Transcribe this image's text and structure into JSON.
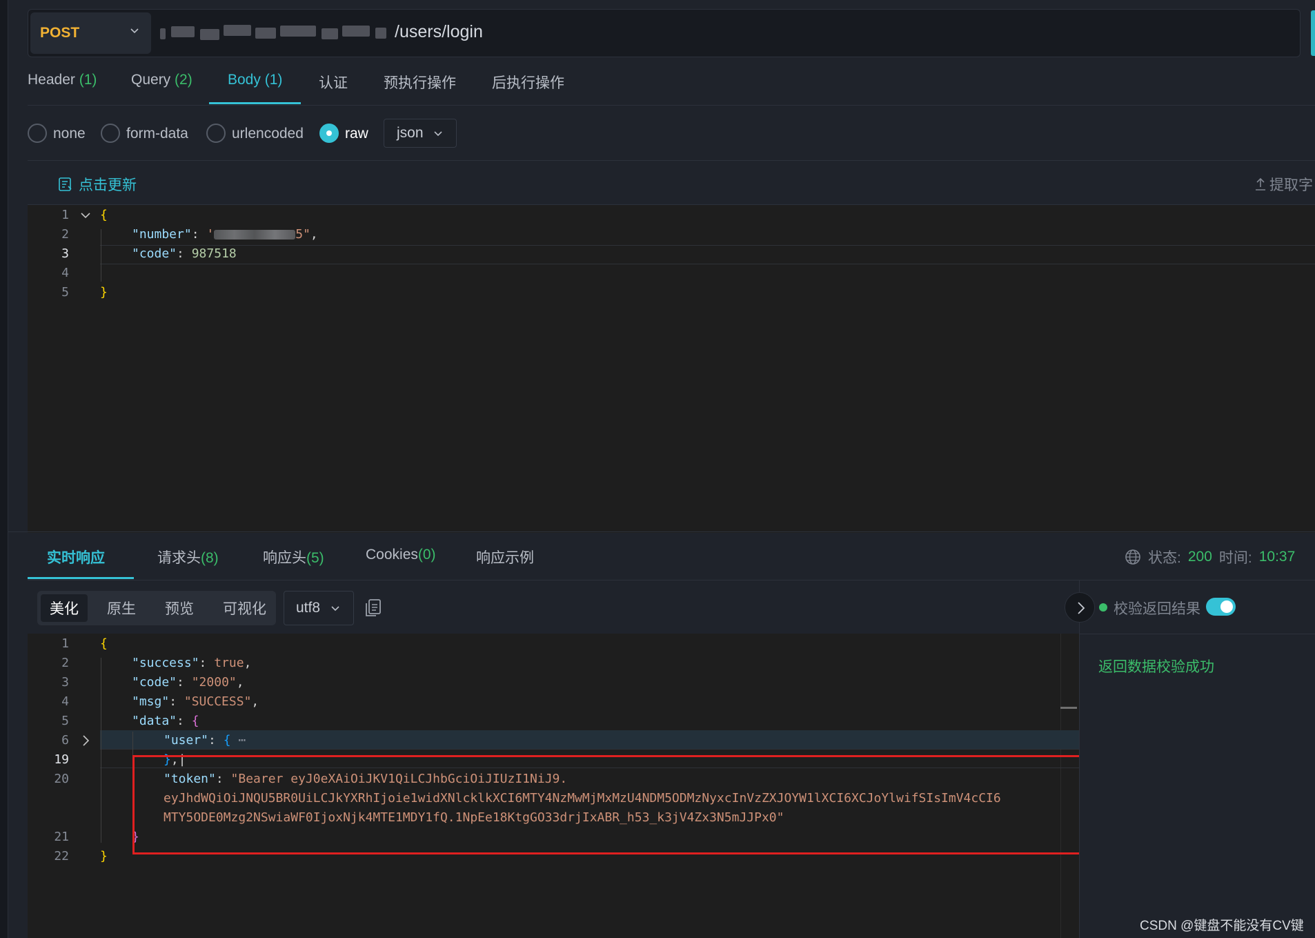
{
  "request": {
    "method": "POST",
    "url_visible": "/users/login"
  },
  "request_tabs": [
    {
      "label": "Header",
      "count": "(1)"
    },
    {
      "label": "Query",
      "count": "(2)"
    },
    {
      "label": "Body",
      "count": "(1)"
    },
    {
      "label": "认证",
      "count": ""
    },
    {
      "label": "预执行操作",
      "count": ""
    },
    {
      "label": "后执行操作",
      "count": ""
    }
  ],
  "body_types": [
    {
      "label": "none",
      "checked": false
    },
    {
      "label": "form-data",
      "checked": false
    },
    {
      "label": "urlencoded",
      "checked": false
    },
    {
      "label": "raw",
      "checked": true
    }
  ],
  "body_format": "json",
  "editor_toolbar": {
    "update_label": "点击更新",
    "extract_label": "提取字"
  },
  "request_body": {
    "line_numbers": [
      "1",
      "2",
      "3",
      "4",
      "5"
    ],
    "number_key": "\"number\"",
    "number_value_tail": "5\"",
    "code_key": "\"code\"",
    "code_value": "987518"
  },
  "response_tabs": [
    {
      "label": "实时响应",
      "count": ""
    },
    {
      "label": "请求头",
      "count": "(8)"
    },
    {
      "label": "响应头",
      "count": "(5)"
    },
    {
      "label": "Cookies",
      "count": "(0)"
    },
    {
      "label": "响应示例",
      "count": ""
    }
  ],
  "status": {
    "status_label": "状态:",
    "status_value": "200",
    "time_label": "时间:",
    "time_value": "10:37"
  },
  "view_modes": [
    "美化",
    "原生",
    "预览",
    "可视化"
  ],
  "charset": "utf8",
  "response_body": {
    "line_numbers": [
      "1",
      "2",
      "3",
      "4",
      "5",
      "6",
      "19",
      "20",
      "",
      "",
      "21",
      "22"
    ],
    "success_key": "\"success\"",
    "success_value": "true",
    "code_key": "\"code\"",
    "code_value": "\"2000\"",
    "msg_key": "\"msg\"",
    "msg_value": "\"SUCCESS\"",
    "data_key": "\"data\"",
    "user_key": "\"user\"",
    "token_key": "\"token\"",
    "token_line1": "\"Bearer eyJ0eXAiOiJKV1QiLCJhbGciOiJIUzI1NiJ9.",
    "token_line2": "eyJhdWQiOiJNQU5BR0UiLCJkYXRhIjoie1widXNlcklkXCI6MTY4NzMwMjMxMzU4NDM5ODMzNyxcInVzZXJOYW1lXCI6XCJoYlwifSIsImV4cCI6",
    "token_line3": "MTY5ODE0Mzg2NSwiaWF0IjoxNjk4MTE1MDY1fQ.1NpEe18KtgGO33drjIxABR_h53_k3jV4Zx3N5mJJPx0\""
  },
  "validation": {
    "label": "校验返回结果",
    "enabled": true,
    "result": "返回数据校验成功"
  },
  "watermark": "CSDN @键盘不能没有CV键",
  "colors": {
    "accent": "#35c2d6",
    "success": "#3bbd6a",
    "method": "#f2b233",
    "highlight_box": "#e02020"
  }
}
